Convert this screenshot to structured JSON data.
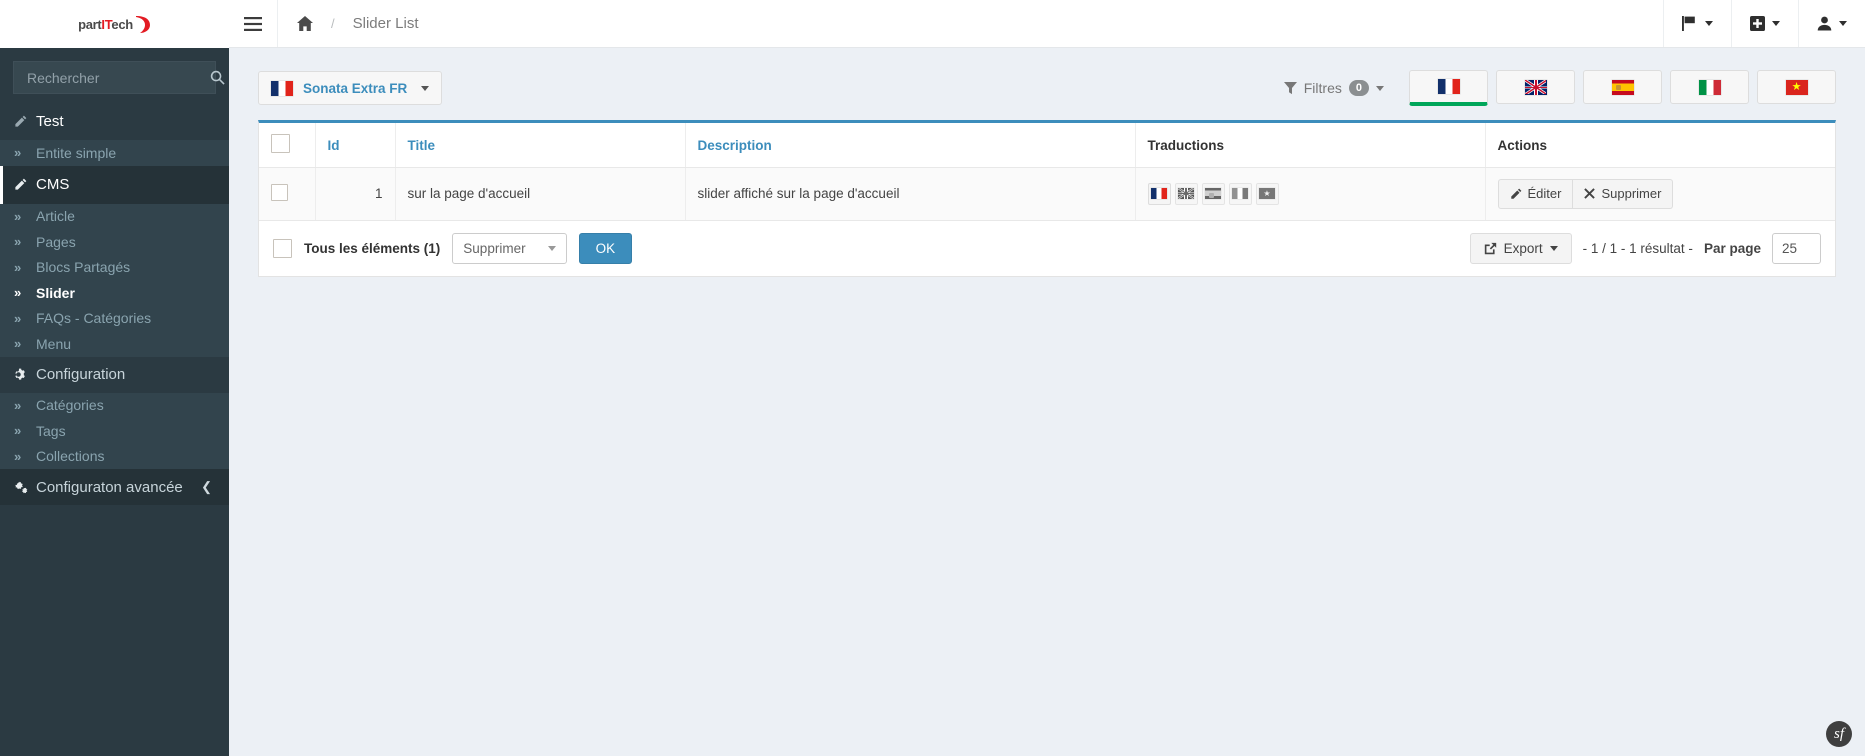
{
  "brand": {
    "name_prefix": "part",
    "name_accent": "IT",
    "name_suffix": "ech",
    "accent_color": "#e31b23"
  },
  "sidebar": {
    "search": {
      "placeholder": "Rechercher",
      "value": "",
      "icon": "search-icon"
    },
    "items": [
      {
        "label": "Test",
        "icon": "pencil-icon",
        "type": "header",
        "active": false
      },
      {
        "label": "Entite simple",
        "icon": "angle-double-right-icon",
        "type": "sub",
        "active": false
      },
      {
        "label": "CMS",
        "icon": "pencil-icon",
        "type": "header",
        "active": true
      },
      {
        "label": "Article",
        "icon": "angle-double-right-icon",
        "type": "sub",
        "active": false
      },
      {
        "label": "Pages",
        "icon": "angle-double-right-icon",
        "type": "sub",
        "active": false
      },
      {
        "label": "Blocs Partagés",
        "icon": "angle-double-right-icon",
        "type": "sub",
        "active": false
      },
      {
        "label": "Slider",
        "icon": "angle-double-right-icon",
        "type": "sub",
        "active": true
      },
      {
        "label": "FAQs - Catégories",
        "icon": "angle-double-right-icon",
        "type": "sub",
        "active": false
      },
      {
        "label": "Menu",
        "icon": "angle-double-right-icon",
        "type": "sub",
        "active": false
      },
      {
        "label": "Configuration",
        "icon": "gear-icon",
        "type": "header",
        "active": false
      },
      {
        "label": "Catégories",
        "icon": "angle-double-right-icon",
        "type": "sub",
        "active": false
      },
      {
        "label": "Tags",
        "icon": "angle-double-right-icon",
        "type": "sub",
        "active": false
      },
      {
        "label": "Collections",
        "icon": "angle-double-right-icon",
        "type": "sub",
        "active": false
      },
      {
        "label": "Configuraton avancée",
        "icon": "gears-icon",
        "type": "advanced",
        "active": false
      }
    ]
  },
  "topbar": {
    "menu_toggle_icon": "hamburger-icon",
    "breadcrumb": {
      "home_icon": "home-icon",
      "separator": "/",
      "current": "Slider List"
    },
    "actions": [
      {
        "name": "flag-menu",
        "icon": "flag-icon"
      },
      {
        "name": "add-menu",
        "icon": "plus-square-icon"
      },
      {
        "name": "user-menu",
        "icon": "user-icon"
      }
    ]
  },
  "toolbar": {
    "locale_switcher": {
      "label": "Sonata Extra FR",
      "flag": "fr"
    },
    "filters": {
      "label": "Filtres",
      "count": "0",
      "icon": "filter-icon"
    },
    "locale_flags": [
      {
        "code": "fr",
        "name": "France",
        "active": true
      },
      {
        "code": "gb",
        "name": "United Kingdom",
        "active": false
      },
      {
        "code": "es",
        "name": "Spain",
        "active": false
      },
      {
        "code": "it",
        "name": "Italy",
        "active": false
      },
      {
        "code": "vn",
        "name": "Vietnam",
        "active": false
      }
    ]
  },
  "table": {
    "columns": [
      {
        "key": "checkbox",
        "label": "",
        "sortable": false
      },
      {
        "key": "id",
        "label": "Id",
        "sortable": true
      },
      {
        "key": "title",
        "label": "Title",
        "sortable": true
      },
      {
        "key": "description",
        "label": "Description",
        "sortable": true
      },
      {
        "key": "traductions",
        "label": "Traductions",
        "sortable": false
      },
      {
        "key": "actions",
        "label": "Actions",
        "sortable": false
      }
    ],
    "rows": [
      {
        "id": "1",
        "title": "sur la page d'accueil",
        "description": "slider affiché sur la page d'accueil",
        "traductions": [
          {
            "code": "fr",
            "active": true
          },
          {
            "code": "gb",
            "active": false
          },
          {
            "code": "es",
            "active": false
          },
          {
            "code": "it",
            "active": false
          },
          {
            "code": "vn",
            "active": false
          }
        ],
        "actions": [
          {
            "label": "Éditer",
            "icon": "pencil-icon"
          },
          {
            "label": "Supprimer",
            "icon": "times-icon"
          }
        ]
      }
    ]
  },
  "footer": {
    "select_all_label": "Tous les éléments (1)",
    "batch_action": "Supprimer",
    "ok_label": "OK",
    "export_label": "Export",
    "export_icon": "share-square-icon",
    "pager": "- 1 / 1 - 1 résultat -",
    "per_page_label": "Par page",
    "per_page_value": "25"
  },
  "debug": {
    "symfony_label": "sf"
  },
  "colors": {
    "sidebar_bg": "#2b3a42",
    "accent_blue": "#3c8dbc",
    "active_green": "#00a65a",
    "page_bg": "#ecf0f5"
  }
}
